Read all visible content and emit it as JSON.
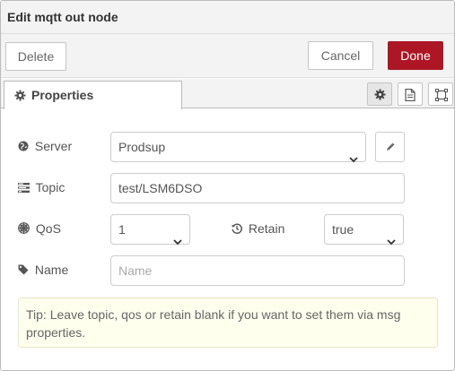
{
  "dialog": {
    "title": "Edit mqtt out node"
  },
  "toolbar": {
    "delete_label": "Delete",
    "cancel_label": "Cancel",
    "done_label": "Done",
    "done_color": "#ad1625"
  },
  "tabs": {
    "properties_label": "Properties",
    "icons": [
      "gear-icon",
      "document-icon",
      "frame-icon"
    ]
  },
  "form": {
    "server": {
      "label": "Server",
      "value": "Prodsup",
      "icon": "globe-icon"
    },
    "topic": {
      "label": "Topic",
      "value": "test/LSM6DSO",
      "icon": "tasks-icon"
    },
    "qos": {
      "label": "QoS",
      "value": "1",
      "icon": "empire-icon"
    },
    "retain": {
      "label": "Retain",
      "value": "true",
      "icon": "history-icon"
    },
    "name": {
      "label": "Name",
      "placeholder": "Name",
      "icon": "tag-icon"
    }
  },
  "tip": {
    "text": "Tip: Leave topic, qos or retain blank if you want to set them via msg properties."
  }
}
